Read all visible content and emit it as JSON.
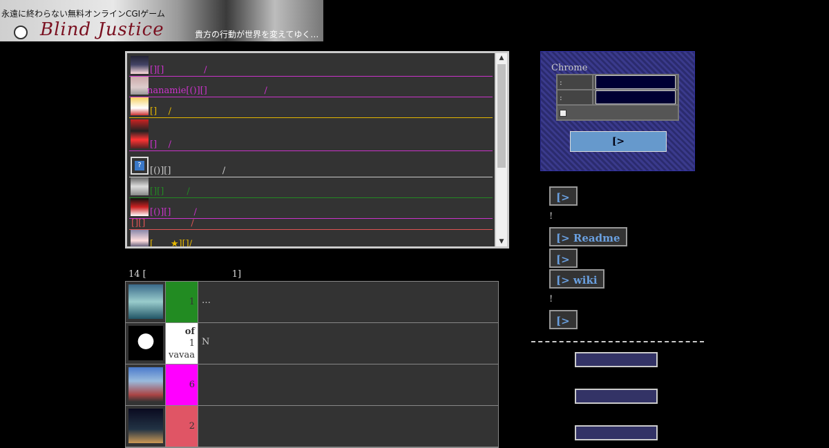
{
  "banner": {
    "top_text": "永遠に終わらない無料オンラインCGIゲーム",
    "logo": "Blind Justice",
    "slogan": "貴方の行動が世界を変えてゆく…"
  },
  "chat": {
    "messages": [
      {
        "text": "[][]              /",
        "color": "#cc33cc"
      },
      {
        "text": "nanamie[()][]                    /",
        "color": "#cc33cc"
      },
      {
        "text": "[]    /",
        "color": "#e6b800"
      },
      {
        "text": "[]    /",
        "color": "#cc33cc"
      },
      {
        "text": "[()][]                  /",
        "color": "#cccccc"
      },
      {
        "text": "[][]        /",
        "color": "#228b22"
      },
      {
        "text": "[()][]        /",
        "color": "#cc33cc"
      },
      {
        "text": "[][]                /",
        "color": "#e05555"
      },
      {
        "text": "[      ★][]/",
        "color": "#e6b800"
      }
    ],
    "up_arrow": "▲",
    "down_arrow": "▼"
  },
  "ranking": {
    "title": "14 [                              1]",
    "rows": [
      {
        "rank": "1",
        "extra": "",
        "note": "…",
        "color": "#228b22"
      },
      {
        "rank": "1",
        "extra_top": "of",
        "extra_bottom": "vavaa",
        "note": "N",
        "color": "#ffffff"
      },
      {
        "rank": "6",
        "note": "",
        "color": "#ff00ff"
      },
      {
        "rank": "2",
        "note": "",
        "color": "#e05565"
      }
    ]
  },
  "login": {
    "brand": "Chrome",
    "label1": ":",
    "label2": ":",
    "submit": "[>"
  },
  "side": {
    "btn1": "[>",
    "bang1": "!",
    "btn2": "[> Readme",
    "btn3": "[>",
    "btn4": "[> wiki",
    "bang2": "!",
    "btn5": "[>"
  }
}
